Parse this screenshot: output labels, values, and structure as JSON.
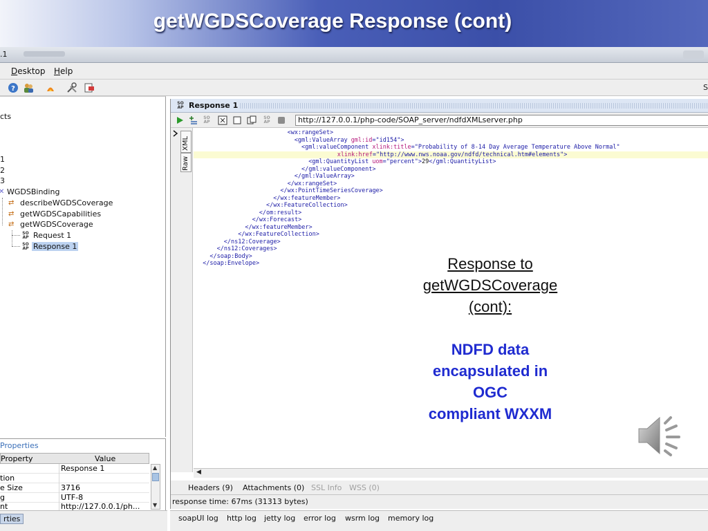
{
  "slide": {
    "title": "getWGDSCoverage Response (cont)",
    "annotation_heading_lines": [
      "Response to",
      "getWGDSCoverage",
      "(cont):"
    ],
    "annotation_body_lines": [
      "NDFD data",
      "encapsulated in",
      "OGC",
      "compliant WXXM"
    ]
  },
  "window": {
    "title_fragment": ".1"
  },
  "menu": {
    "items": [
      {
        "mnemonic": "D",
        "rest": "esktop"
      },
      {
        "mnemonic": "H",
        "rest": "elp"
      }
    ]
  },
  "toolbar": {
    "right_fragment": "S"
  },
  "navigator": {
    "tree": [
      {
        "label": "cts"
      },
      {
        "label": "1"
      },
      {
        "label": "2"
      },
      {
        "label": "3"
      },
      {
        "label": "WGDSBinding"
      },
      {
        "label": "describeWGDSCoverage"
      },
      {
        "label": "getWGDSCapabilities"
      },
      {
        "label": "getWGDSCoverage"
      },
      {
        "label": "Request 1"
      },
      {
        "label": "Response 1"
      }
    ]
  },
  "properties": {
    "title": "Properties",
    "col_property": "Property",
    "col_value": "Value",
    "rows": [
      {
        "name": "",
        "value": "Response 1"
      },
      {
        "name": "tion",
        "value": ""
      },
      {
        "name": "e Size",
        "value": "3716"
      },
      {
        "name": "g",
        "value": "UTF-8"
      },
      {
        "name": "nt",
        "value": "http://127.0.0.1/ph..."
      }
    ],
    "bottom_tab": "rties"
  },
  "response": {
    "title": "Response 1",
    "url": "http://127.0.0.1/php-code/SOAP_server/ndfdXMLserver.php",
    "side_tabs": [
      "XML",
      "Raw"
    ],
    "lines": [
      {
        "indent": 26,
        "parts": [
          [
            "t",
            "<wx:rangeSet>"
          ]
        ]
      },
      {
        "indent": 28,
        "parts": [
          [
            "t",
            "<gml:ValueArray "
          ],
          [
            "a",
            "gml:id"
          ],
          [
            "t",
            "=\"id154\">"
          ]
        ]
      },
      {
        "indent": 30,
        "parts": [
          [
            "t",
            "<gml:valueComponent "
          ],
          [
            "a",
            "xlink:title"
          ],
          [
            "t",
            "=\"Probability of 8-14 Day Average Temperature Above Normal\""
          ]
        ]
      },
      {
        "indent": 0,
        "hl": true,
        "parts": [
          [
            "a",
            "                                        xlink:href"
          ],
          [
            "t",
            "=\"http://www.nws.noaa.gov/ndfd/technical.htm#elements\">"
          ]
        ]
      },
      {
        "indent": 32,
        "parts": [
          [
            "t",
            "<gml:QuantityList "
          ],
          [
            "a",
            "uom"
          ],
          [
            "t",
            "=\"percent\">"
          ],
          [
            "x",
            "29"
          ],
          [
            "t",
            "</gml:QuantityList>"
          ]
        ]
      },
      {
        "indent": 30,
        "parts": [
          [
            "t",
            "</gml:valueComponent>"
          ]
        ]
      },
      {
        "indent": 28,
        "parts": [
          [
            "t",
            "</gml:ValueArray>"
          ]
        ]
      },
      {
        "indent": 26,
        "parts": [
          [
            "t",
            "</wx:rangeSet>"
          ]
        ]
      },
      {
        "indent": 24,
        "parts": [
          [
            "t",
            "</wx:PointTimeSeriesCoverage>"
          ]
        ]
      },
      {
        "indent": 22,
        "parts": [
          [
            "t",
            "</wx:featureMember>"
          ]
        ]
      },
      {
        "indent": 20,
        "parts": [
          [
            "t",
            "</wx:FeatureCollection>"
          ]
        ]
      },
      {
        "indent": 18,
        "parts": [
          [
            "t",
            "</om:result>"
          ]
        ]
      },
      {
        "indent": 16,
        "parts": [
          [
            "t",
            "</wx:Forecast>"
          ]
        ]
      },
      {
        "indent": 14,
        "parts": [
          [
            "t",
            "</wx:featureMember>"
          ]
        ]
      },
      {
        "indent": 12,
        "parts": [
          [
            "t",
            "</wx:FeatureCollection>"
          ]
        ]
      },
      {
        "indent": 8,
        "parts": [
          [
            "t",
            "</ns12:Coverage>"
          ]
        ]
      },
      {
        "indent": 6,
        "parts": [
          [
            "t",
            "</ns12:Coverages>"
          ]
        ]
      },
      {
        "indent": 4,
        "parts": [
          [
            "t",
            "</soap:Body>"
          ]
        ]
      },
      {
        "indent": 2,
        "parts": [
          [
            "t",
            "</soap:Envelope>"
          ]
        ]
      }
    ],
    "tabs": [
      {
        "label": "Headers (9)",
        "enabled": true
      },
      {
        "label": "Attachments (0)",
        "enabled": true
      },
      {
        "label": "SSL Info",
        "enabled": false
      },
      {
        "label": "WSS (0)",
        "enabled": false
      }
    ],
    "status": "response time: 67ms (31313 bytes)"
  },
  "logs": {
    "tabs": [
      "soapUI log",
      "http log",
      "jetty log",
      "error log",
      "wsrm log",
      "memory log"
    ]
  },
  "colors": {
    "banner": "#3b4fa8",
    "annotation_body": "#1f2bd0",
    "selection": "#bcd2f0",
    "xml_tag": "#1a1aa6",
    "xml_attr": "#b4187a"
  },
  "icons": [
    "sound-speaker-icon",
    "run-icon",
    "soap-icon"
  ]
}
